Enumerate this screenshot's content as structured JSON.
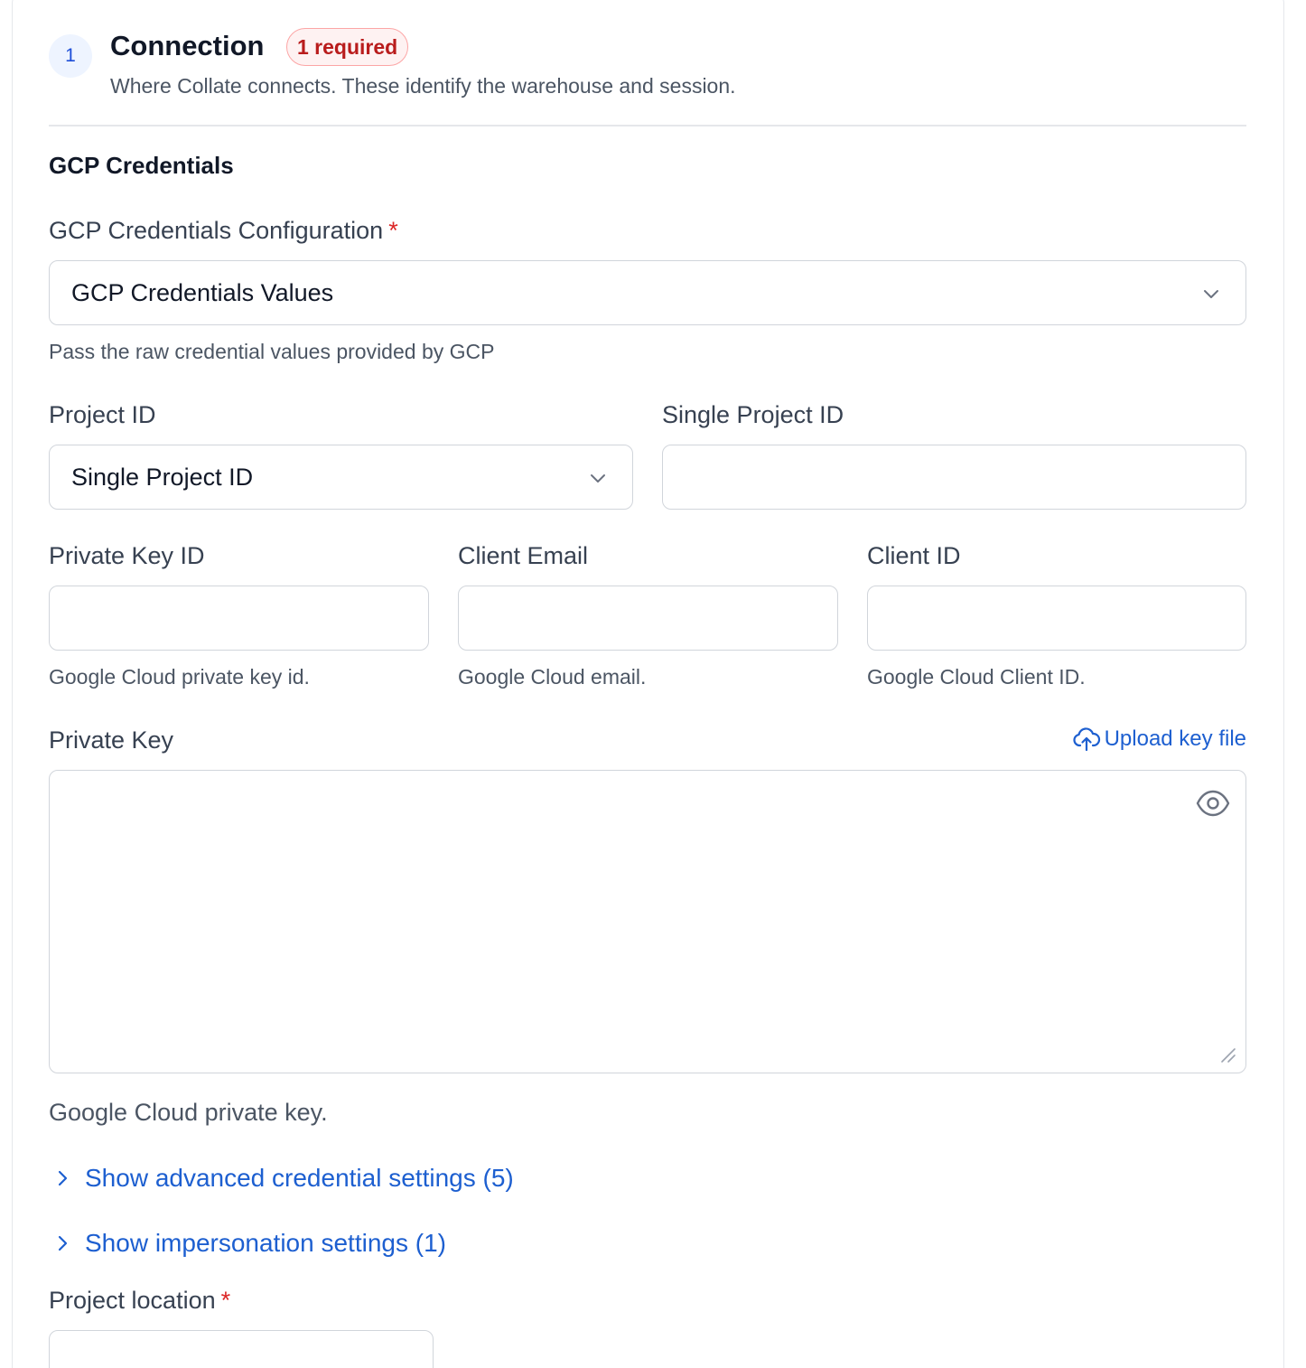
{
  "section": {
    "step": "1",
    "title": "Connection",
    "badge": "1 required",
    "subtitle": "Where Collate connects. These identify the warehouse and session."
  },
  "gcp": {
    "group_title": "GCP Credentials",
    "config_label": "GCP Credentials Configuration",
    "config_value": "GCP Credentials Values",
    "config_help": "Pass the raw credential values provided by GCP",
    "project_id_label": "Project ID",
    "project_id_value": "Single Project ID",
    "single_project_id_label": "Single Project ID",
    "single_project_id_value": "",
    "private_key_id_label": "Private Key ID",
    "private_key_id_help": "Google Cloud private key id.",
    "client_email_label": "Client Email",
    "client_email_help": "Google Cloud email.",
    "client_id_label": "Client ID",
    "client_id_help": "Google Cloud Client ID.",
    "private_key_label": "Private Key",
    "upload_label": "Upload key file",
    "private_key_help": "Google Cloud private key."
  },
  "toggles": {
    "advanced": "Show advanced credential settings (5)",
    "impersonation": "Show impersonation settings (1)"
  },
  "location": {
    "label": "Project location"
  },
  "icons": {
    "dropdown": "chevron-down-icon",
    "upload": "cloud-upload-icon",
    "visibility": "eye-icon",
    "expand": "chevron-right-icon",
    "resize": "resize-handle-icon"
  },
  "colors": {
    "accent": "#1d5fd0",
    "required": "#dc2626",
    "badge_text": "#b91c1c"
  }
}
